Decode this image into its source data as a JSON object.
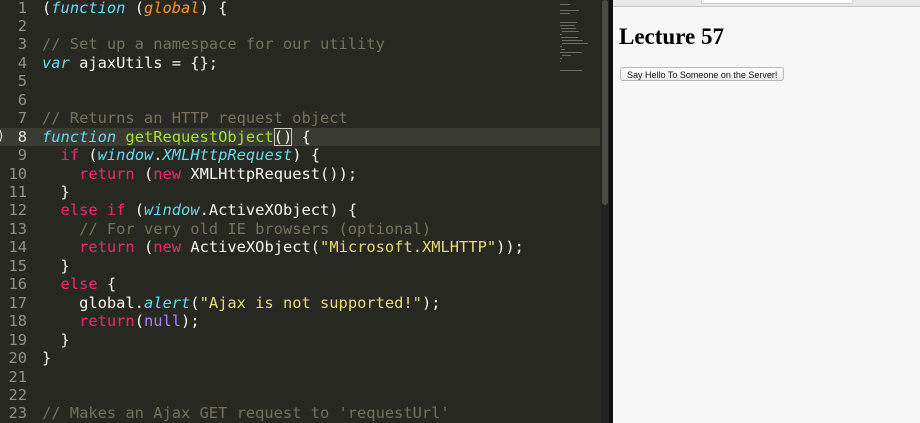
{
  "editor": {
    "current_line": 8,
    "fold_marker": "⟩",
    "lines": [
      {
        "n": "1",
        "tokens": [
          {
            "t": "(",
            "c": "t-paren"
          },
          {
            "t": "function",
            "c": "t-kw"
          },
          {
            "t": " (",
            "c": "t-paren"
          },
          {
            "t": "global",
            "c": "t-italic-g"
          },
          {
            "t": ") {",
            "c": "t-paren"
          }
        ]
      },
      {
        "n": "2",
        "tokens": []
      },
      {
        "n": "3",
        "tokens": [
          {
            "t": "// Set up a namespace for our utility",
            "c": "t-comment"
          }
        ]
      },
      {
        "n": "4",
        "tokens": [
          {
            "t": "var",
            "c": "t-kw"
          },
          {
            "t": " ajaxUtils = {};",
            "c": "t-plain"
          }
        ]
      },
      {
        "n": "5",
        "tokens": []
      },
      {
        "n": "6",
        "tokens": []
      },
      {
        "n": "7",
        "tokens": [
          {
            "t": "// Returns an HTTP request object",
            "c": "t-comment"
          }
        ]
      },
      {
        "n": "8",
        "tokens": [
          {
            "t": "function",
            "c": "t-kw"
          },
          {
            "t": " ",
            "c": "t-plain"
          },
          {
            "t": "getRequestObject",
            "c": "t-fn"
          },
          {
            "t": "()",
            "c": "t-plain",
            "box": true
          },
          {
            "t": " {",
            "c": "t-plain"
          }
        ]
      },
      {
        "n": "9",
        "tokens": [
          {
            "t": "  ",
            "c": "t-plain"
          },
          {
            "t": "if",
            "c": "t-ctrl"
          },
          {
            "t": " (",
            "c": "t-plain"
          },
          {
            "t": "window",
            "c": "t-var"
          },
          {
            "t": ".",
            "c": "t-plain"
          },
          {
            "t": "XMLHttpRequest",
            "c": "t-var"
          },
          {
            "t": ") {",
            "c": "t-plain"
          }
        ]
      },
      {
        "n": "10",
        "tokens": [
          {
            "t": "    ",
            "c": "t-plain"
          },
          {
            "t": "return",
            "c": "t-ctrl"
          },
          {
            "t": " (",
            "c": "t-plain"
          },
          {
            "t": "new",
            "c": "t-ctrl"
          },
          {
            "t": " XMLHttpRequest());",
            "c": "t-plain"
          }
        ]
      },
      {
        "n": "11",
        "tokens": [
          {
            "t": "  }",
            "c": "t-plain"
          }
        ]
      },
      {
        "n": "12",
        "tokens": [
          {
            "t": "  ",
            "c": "t-plain"
          },
          {
            "t": "else if",
            "c": "t-ctrl"
          },
          {
            "t": " (",
            "c": "t-plain"
          },
          {
            "t": "window",
            "c": "t-var"
          },
          {
            "t": ".ActiveXObject) {",
            "c": "t-plain"
          }
        ]
      },
      {
        "n": "13",
        "tokens": [
          {
            "t": "    ",
            "c": "t-plain"
          },
          {
            "t": "// For very old IE browsers (optional)",
            "c": "t-comment"
          }
        ]
      },
      {
        "n": "14",
        "tokens": [
          {
            "t": "    ",
            "c": "t-plain"
          },
          {
            "t": "return",
            "c": "t-ctrl"
          },
          {
            "t": " (",
            "c": "t-plain"
          },
          {
            "t": "new",
            "c": "t-ctrl"
          },
          {
            "t": " ActiveXObject(",
            "c": "t-plain"
          },
          {
            "t": "\"Microsoft.XMLHTTP\"",
            "c": "t-str"
          },
          {
            "t": "));",
            "c": "t-plain"
          }
        ]
      },
      {
        "n": "15",
        "tokens": [
          {
            "t": "  }",
            "c": "t-plain"
          }
        ]
      },
      {
        "n": "16",
        "tokens": [
          {
            "t": "  ",
            "c": "t-plain"
          },
          {
            "t": "else",
            "c": "t-ctrl"
          },
          {
            "t": " {",
            "c": "t-plain"
          }
        ]
      },
      {
        "n": "17",
        "tokens": [
          {
            "t": "    global.",
            "c": "t-plain"
          },
          {
            "t": "alert",
            "c": "t-var"
          },
          {
            "t": "(",
            "c": "t-plain"
          },
          {
            "t": "\"Ajax is not supported!\"",
            "c": "t-str"
          },
          {
            "t": ");",
            "c": "t-plain"
          }
        ]
      },
      {
        "n": "18",
        "tokens": [
          {
            "t": "    ",
            "c": "t-plain"
          },
          {
            "t": "return",
            "c": "t-ctrl"
          },
          {
            "t": "(",
            "c": "t-plain"
          },
          {
            "t": "null",
            "c": "t-const"
          },
          {
            "t": ");",
            "c": "t-plain"
          }
        ]
      },
      {
        "n": "19",
        "tokens": [
          {
            "t": "  }",
            "c": "t-plain"
          }
        ]
      },
      {
        "n": "20",
        "tokens": [
          {
            "t": "}",
            "c": "t-plain"
          }
        ]
      },
      {
        "n": "21",
        "tokens": []
      },
      {
        "n": "22",
        "tokens": []
      },
      {
        "n": "23",
        "tokens": [
          {
            "t": "// Makes an Ajax GET request to 'requestUrl'",
            "c": "t-comment"
          }
        ]
      }
    ]
  },
  "browser": {
    "page_title": "Lecture 57",
    "button_label": "Say Hello To Someone on the Server!"
  },
  "colors": {
    "editor_bg": "#272822",
    "keyword": "#66d9ef",
    "control": "#f92672",
    "function_name": "#a6e22e",
    "string": "#e6db74",
    "comment": "#75715e",
    "constant": "#ae81ff",
    "parameter": "#fd971f"
  }
}
